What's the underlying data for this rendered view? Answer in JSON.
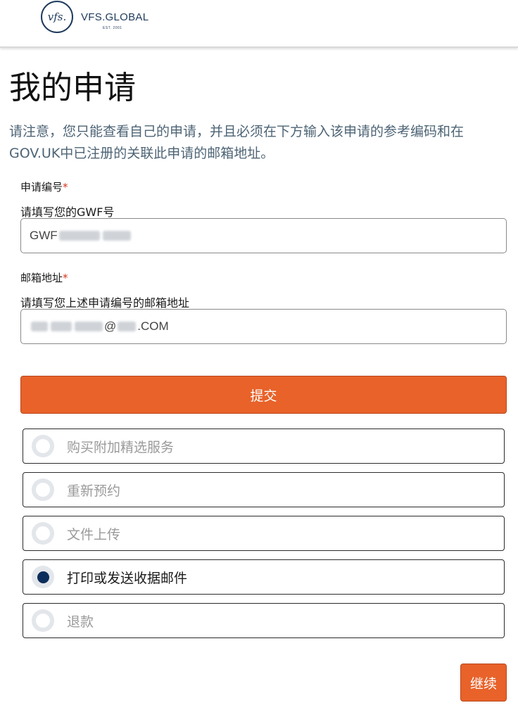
{
  "header": {
    "logo_mark": "vfs.",
    "logo_text": "VFS.GLOBAL",
    "logo_est": "EST. 2001"
  },
  "page": {
    "title": "我的申请",
    "notice": "请注意，您只能查看自己的申请，并且必须在下方输入该申请的参考编码和在GOV.UK中已注册的关联此申请的邮箱地址。"
  },
  "form": {
    "reference": {
      "label": "申请编号",
      "required_mark": "*",
      "hint": "请填写您的GWF号",
      "value_prefix": "GWF"
    },
    "email": {
      "label": "邮箱地址",
      "required_mark": "*",
      "hint": "请填写您上述申请编号的邮箱地址",
      "value_at": "@",
      "value_suffix": ".COM"
    },
    "submit_label": "提交"
  },
  "options": [
    {
      "label": "购买附加精选服务",
      "selected": false
    },
    {
      "label": "重新预约",
      "selected": false
    },
    {
      "label": "文件上传",
      "selected": false
    },
    {
      "label": "打印或发送收据邮件",
      "selected": true
    },
    {
      "label": "退款",
      "selected": false
    }
  ],
  "continue_label": "继续",
  "colors": {
    "accent": "#e8622a",
    "brand": "#1f3a5c",
    "radio_selected": "#0b2d5b"
  }
}
